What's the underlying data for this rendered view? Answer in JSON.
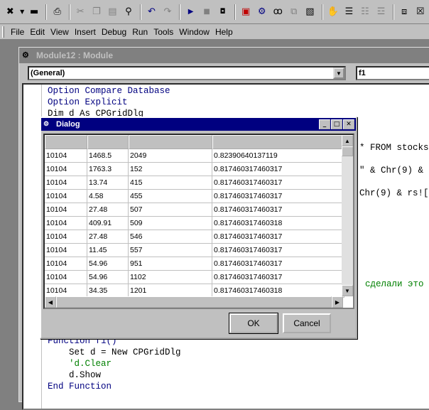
{
  "toolbar": {
    "icons": [
      "run-macro-icon",
      "save-icon",
      "print-icon",
      "cut-icon",
      "copy-icon",
      "paste-icon",
      "find-icon",
      "undo-icon",
      "redo-icon",
      "run-icon",
      "pause-icon",
      "reset-icon",
      "design-mode-icon",
      "references-icon",
      "watch-icon",
      "call-stack-icon",
      "object-browser-icon",
      "hand-icon",
      "indent-icon",
      "comment-icon",
      "uncomment-icon",
      "project-icon",
      "properties-icon"
    ]
  },
  "menu": [
    "File",
    "Edit",
    "View",
    "Insert",
    "Debug",
    "Run",
    "Tools",
    "Window",
    "Help"
  ],
  "module": {
    "title": "Module12 : Module",
    "object_combo": "(General)",
    "proc_combo": "f1"
  },
  "code": [
    {
      "t": "Option Compare Database",
      "c": "kw"
    },
    {
      "t": "Option Explicit",
      "c": "kw"
    },
    {
      "t": "Dim d As CPGridDlg",
      "c": "tx"
    },
    {
      "t": "* FROM stocks",
      "c": "tx"
    },
    {
      "t": "\" & Chr(9) &",
      "c": "tx"
    },
    {
      "t": "Chr(9) & rs![",
      "c": "tx"
    },
    {
      "t": "сделали это",
      "c": "cm"
    },
    {
      "t": "Function f1()",
      "c": "kw"
    },
    {
      "t": "    Set d = New CPGridDlg",
      "c": "tx"
    },
    {
      "t": "    'd.Clear",
      "c": "cm"
    },
    {
      "t": "    d.Show",
      "c": "tx"
    },
    {
      "t": "End Function",
      "c": "kw"
    }
  ],
  "dialog": {
    "title": "Dialog",
    "ok_label": "OK",
    "cancel_label": "Cancel",
    "rows": [
      [
        "10104",
        "1468.5",
        "2049",
        "0.82390640137119"
      ],
      [
        "10104",
        "1763.3",
        "152",
        "0.817460317460317"
      ],
      [
        "10104",
        "13.74",
        "415",
        "0.817460317460317"
      ],
      [
        "10104",
        "4.58",
        "455",
        "0.817460317460317"
      ],
      [
        "10104",
        "27.48",
        "507",
        "0.817460317460317"
      ],
      [
        "10104",
        "409.91",
        "509",
        "0.817460317460318"
      ],
      [
        "10104",
        "27.48",
        "546",
        "0.817460317460317"
      ],
      [
        "10104",
        "11.45",
        "557",
        "0.817460317460317"
      ],
      [
        "10104",
        "54.96",
        "951",
        "0.817460317460317"
      ],
      [
        "10104",
        "54.96",
        "1102",
        "0.817460317460317"
      ],
      [
        "10104",
        "34.35",
        "1201",
        "0.817460317460318"
      ]
    ]
  }
}
